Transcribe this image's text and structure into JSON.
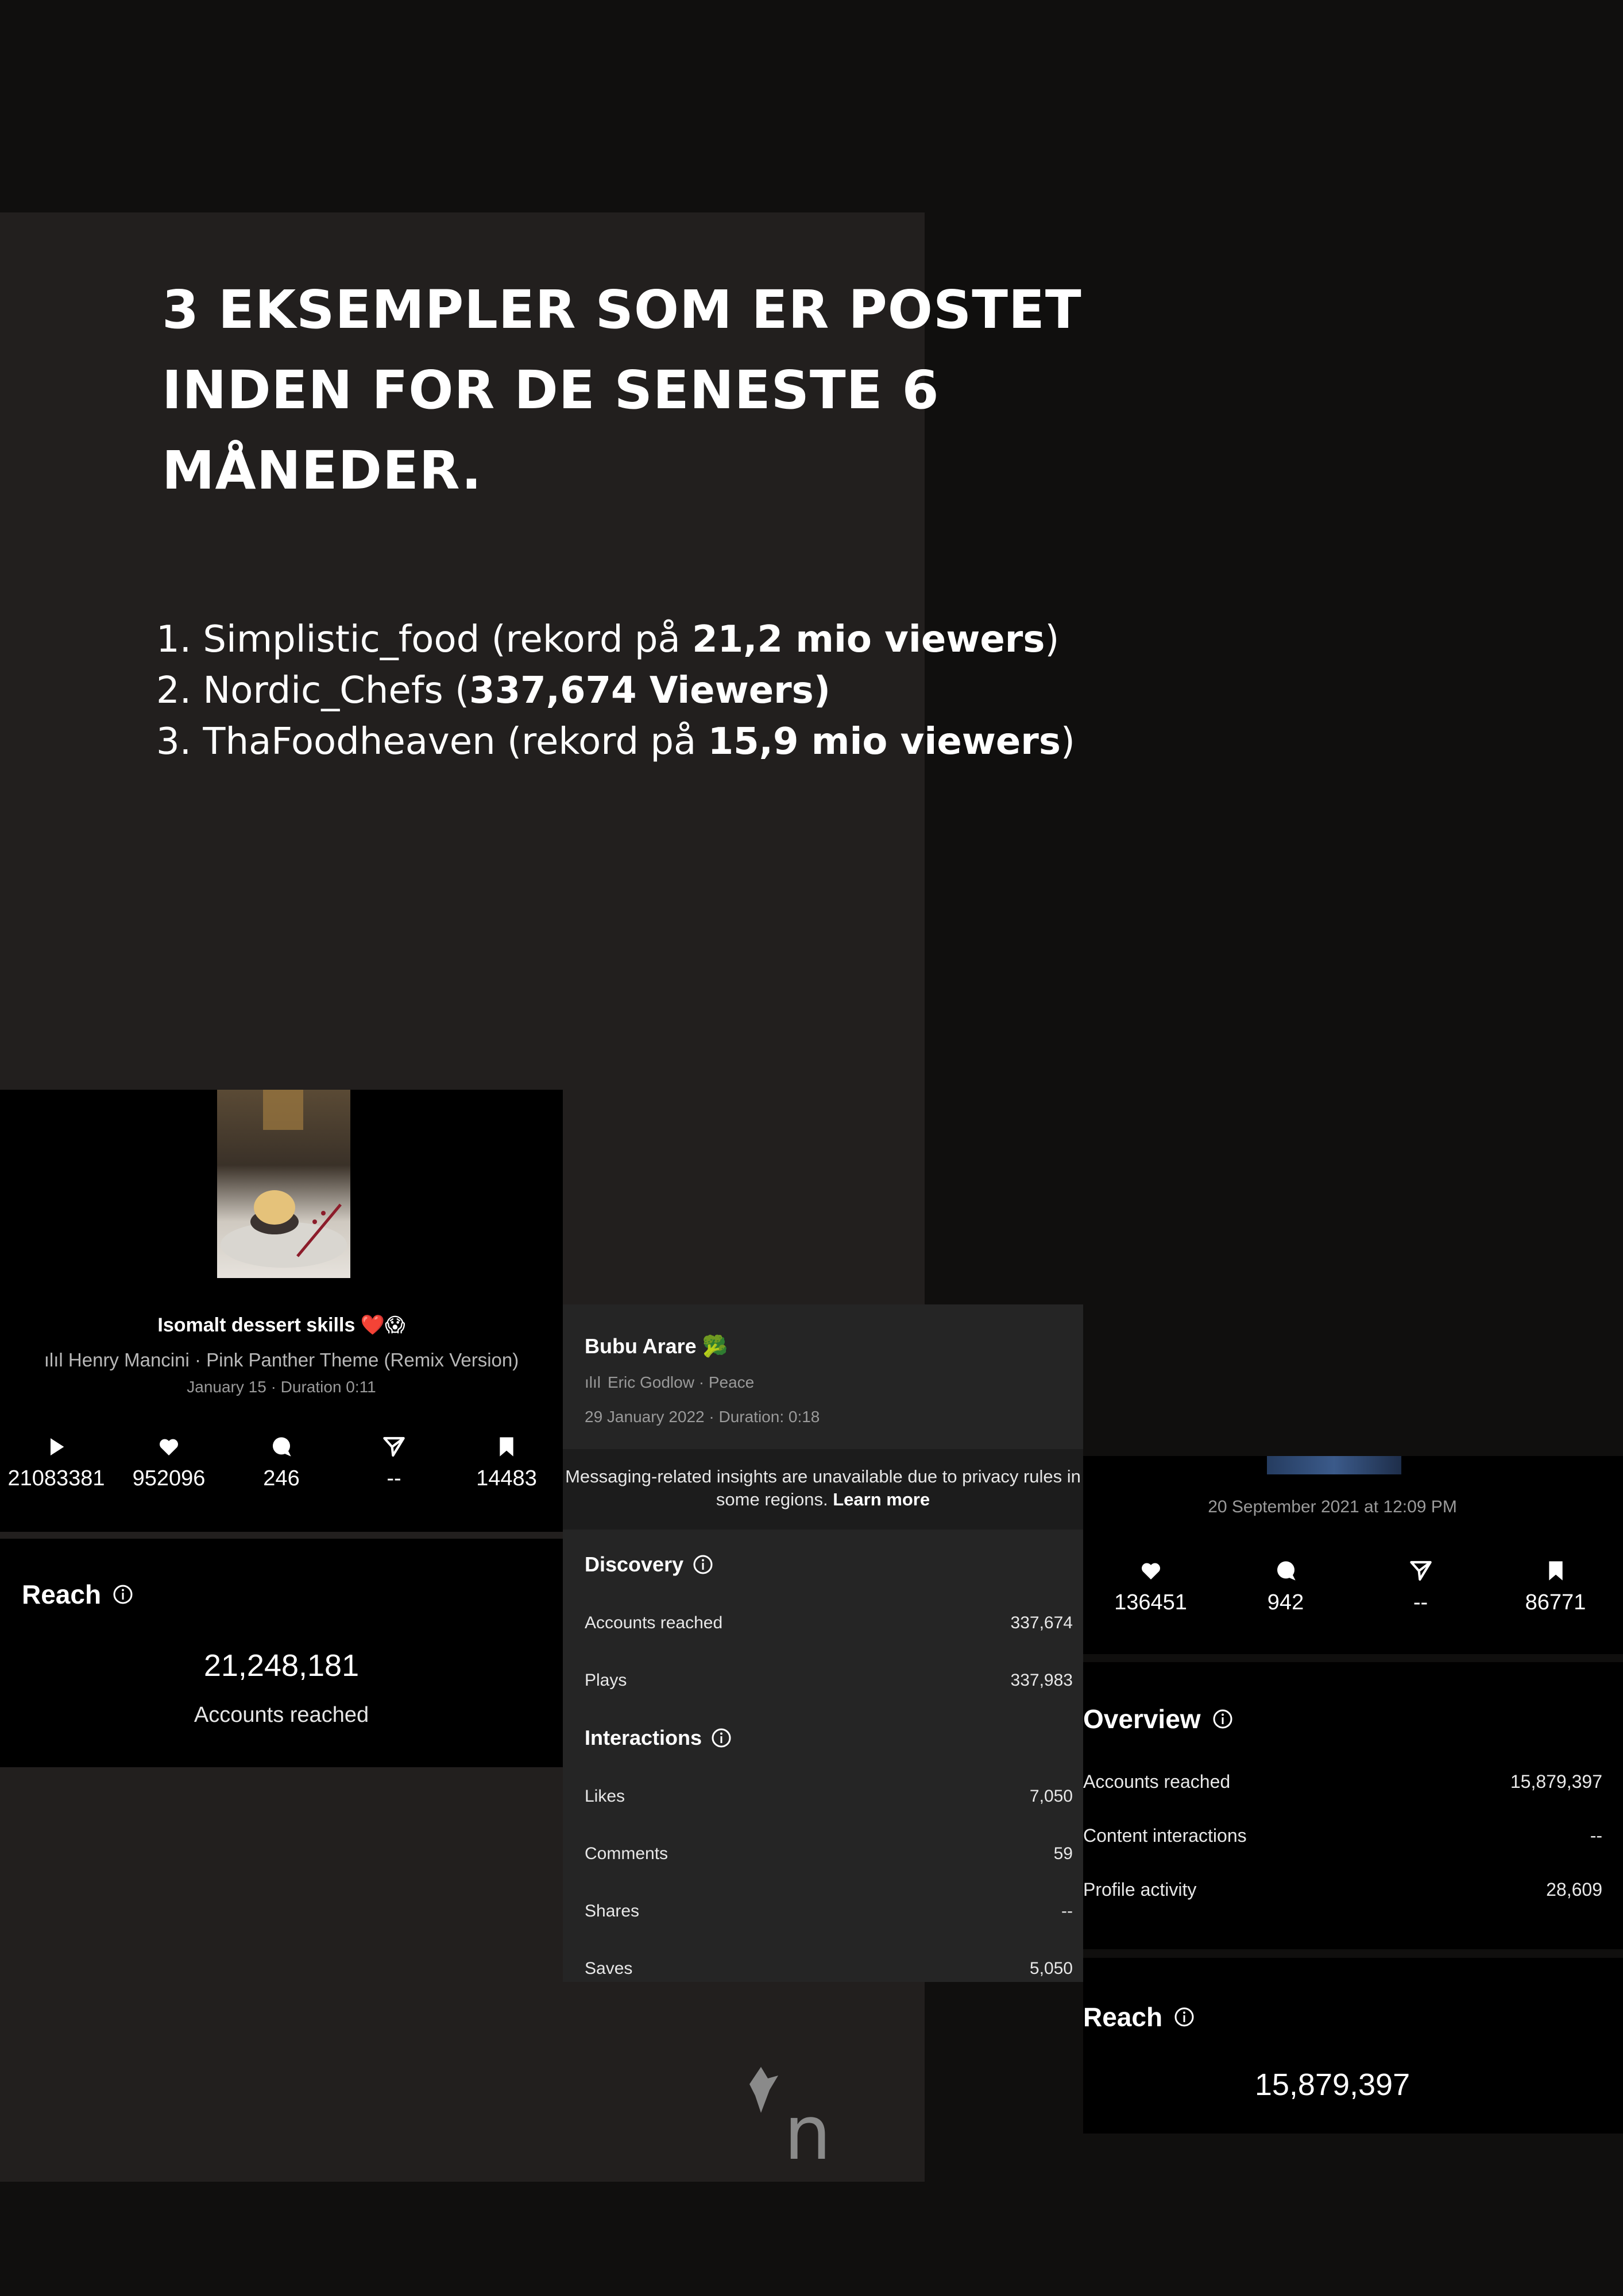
{
  "headline": {
    "line1": "3 EKSEMPLER SOM ER POSTET",
    "line2": "INDEN FOR DE SENESTE 6",
    "line3": "MÅNEDER."
  },
  "examples": [
    {
      "pre": "1. Simplistic_food (rekord på ",
      "bold": "21,2 mio viewers",
      "post": ")"
    },
    {
      "pre": "2. Nordic_Chefs (",
      "bold": "337,674 Viewers)",
      "post": ""
    },
    {
      "pre": "3. ThaFoodheaven (rekord på ",
      "bold": "15,9 mio viewers",
      "post": ")"
    }
  ],
  "card1": {
    "title": "Isomalt dessert skills ❤️😱",
    "music": "Henry Mancini · Pink Panther Theme (Remix Version)",
    "date": "January 15 · Duration 0:11",
    "stats": {
      "plays": "21083381",
      "likes": "952096",
      "comments": "246",
      "shares": "--",
      "saves": "14483"
    },
    "reach_title": "Reach",
    "reach_value": "21,248,181",
    "reach_label": "Accounts reached"
  },
  "card2": {
    "title": "Bubu Arare 🥦",
    "music": "Eric Godlow · Peace",
    "date": "29 January 2022 · Duration: 0:18",
    "notice": "Messaging-related insights are unavailable due to privacy rules in some regions.",
    "notice_link": "Learn more",
    "discovery_title": "Discovery",
    "accounts_reached_label": "Accounts reached",
    "accounts_reached_value": "337,674",
    "plays_label": "Plays",
    "plays_value": "337,983",
    "interactions_title": "Interactions",
    "likes_label": "Likes",
    "likes_value": "7,050",
    "comments_label": "Comments",
    "comments_value": "59",
    "shares_label": "Shares",
    "shares_value": "--",
    "saves_label": "Saves",
    "saves_value": "5,050"
  },
  "card3": {
    "date": "20 September 2021 at 12:09 PM",
    "stats": {
      "likes": "136451",
      "comments": "942",
      "shares": "--",
      "saves": "86771"
    },
    "overview_title": "Overview",
    "rows": [
      {
        "label": "Accounts reached",
        "value": "15,879,397"
      },
      {
        "label": "Content interactions",
        "value": "--"
      },
      {
        "label": "Profile activity",
        "value": "28,609"
      }
    ],
    "reach_title": "Reach",
    "reach_value": "15,879,397"
  },
  "logo": {
    "letter": "n"
  }
}
